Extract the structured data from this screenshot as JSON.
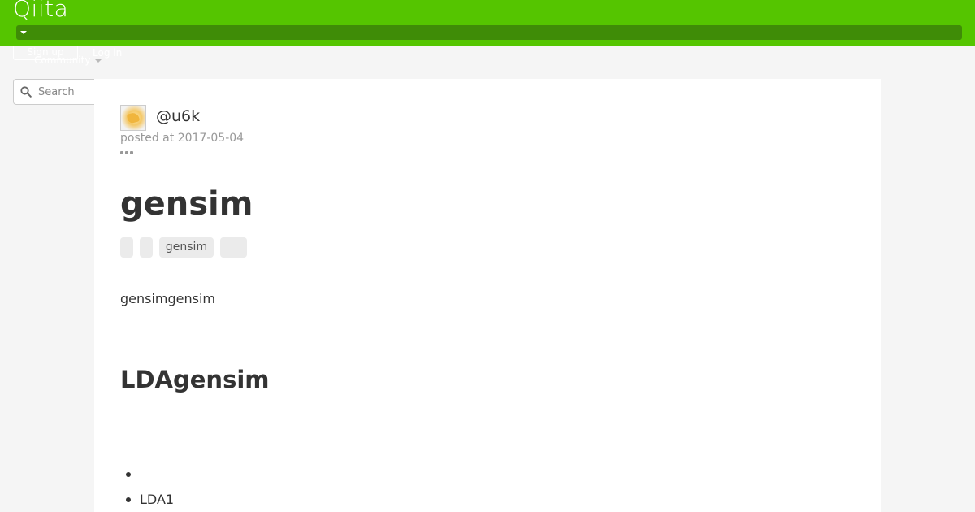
{
  "header": {
    "logo": "Qiita",
    "brand_color": "#55c500",
    "signup_label": "Sign up",
    "login_label": "Log in",
    "community_label": "Community"
  },
  "search": {
    "placeholder": "Search",
    "icon": "search-icon"
  },
  "article": {
    "author": "@u6k",
    "posted": "posted at 2017-05-04",
    "title": "gensim",
    "tags": [
      "",
      "",
      "gensim",
      ""
    ],
    "intro": "gensimgensim",
    "section_heading": "LDAgensim",
    "list_items": [
      "",
      "LDA1"
    ]
  }
}
